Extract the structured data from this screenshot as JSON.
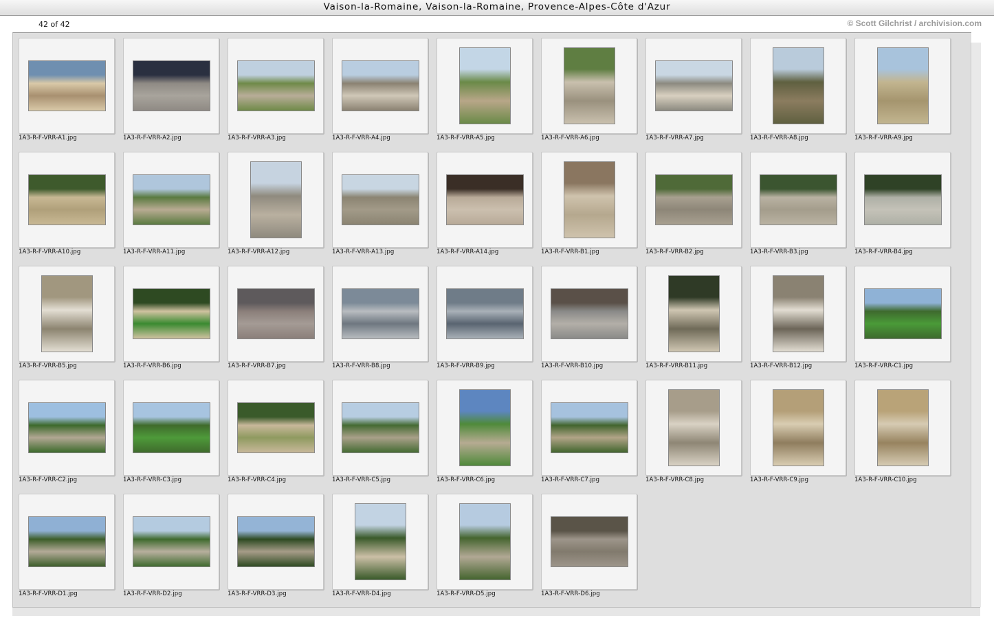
{
  "window": {
    "title": "Vaison-la-Romaine, Vaison-la-Romaine, Provence-Alpes-Côte d'Azur"
  },
  "status": {
    "count": "42 of 42",
    "credit": "© Scott Gilchrist / archivision.com"
  },
  "thumbnails": [
    {
      "file": "1A3-R-F-VRR-A1.jpg",
      "orientation": "landscape",
      "colors": [
        "#6f8fb0",
        "#d9c9a8",
        "#a89070"
      ]
    },
    {
      "file": "1A3-R-F-VRR-A2.jpg",
      "orientation": "landscape",
      "colors": [
        "#2a3040",
        "#8f8a84",
        "#a8a49c"
      ]
    },
    {
      "file": "1A3-R-F-VRR-A3.jpg",
      "orientation": "landscape",
      "colors": [
        "#bfd0df",
        "#6f8a48",
        "#b8ad98"
      ]
    },
    {
      "file": "1A3-R-F-VRR-A4.jpg",
      "orientation": "landscape",
      "colors": [
        "#b9cde0",
        "#8b8272",
        "#cfc7b7"
      ]
    },
    {
      "file": "1A3-R-F-VRR-A5.jpg",
      "orientation": "portrait",
      "colors": [
        "#c3d6e6",
        "#6a8a48",
        "#b8a688"
      ]
    },
    {
      "file": "1A3-R-F-VRR-A6.jpg",
      "orientation": "portrait",
      "colors": [
        "#5f7e42",
        "#c9c0ae",
        "#9a917e"
      ]
    },
    {
      "file": "1A3-R-F-VRR-A7.jpg",
      "orientation": "landscape",
      "colors": [
        "#c9d7e3",
        "#8c8a80",
        "#d8d0c0"
      ]
    },
    {
      "file": "1A3-R-F-VRR-A8.jpg",
      "orientation": "portrait",
      "colors": [
        "#b9cbdb",
        "#5f6040",
        "#8b7c5f"
      ]
    },
    {
      "file": "1A3-R-F-VRR-A9.jpg",
      "orientation": "portrait",
      "colors": [
        "#a8c3dc",
        "#c2b590",
        "#a5956e"
      ]
    },
    {
      "file": "1A3-R-F-VRR-A10.jpg",
      "orientation": "landscape",
      "colors": [
        "#3e5a2c",
        "#c8b894",
        "#b0a07a"
      ]
    },
    {
      "file": "1A3-R-F-VRR-A11.jpg",
      "orientation": "landscape",
      "colors": [
        "#afc6dc",
        "#5a7a40",
        "#b8ab92"
      ]
    },
    {
      "file": "1A3-R-F-VRR-A12.jpg",
      "orientation": "portrait",
      "colors": [
        "#c6d3e0",
        "#8f8a7e",
        "#b9b0a0"
      ]
    },
    {
      "file": "1A3-R-F-VRR-A13.jpg",
      "orientation": "landscape",
      "colors": [
        "#c8d6e2",
        "#8b8472",
        "#a29a88"
      ]
    },
    {
      "file": "1A3-R-F-VRR-A14.jpg",
      "orientation": "landscape",
      "colors": [
        "#3a2e26",
        "#b8aa98",
        "#cbbfae"
      ]
    },
    {
      "file": "1A3-R-F-VRR-B1.jpg",
      "orientation": "portrait",
      "colors": [
        "#8a7660",
        "#cfc3ad",
        "#b5a88e"
      ]
    },
    {
      "file": "1A3-R-F-VRR-B2.jpg",
      "orientation": "landscape",
      "colors": [
        "#4f6a38",
        "#a8a090",
        "#8d8678"
      ]
    },
    {
      "file": "1A3-R-F-VRR-B3.jpg",
      "orientation": "landscape",
      "colors": [
        "#3b5530",
        "#b9b2a2",
        "#a49d8c"
      ]
    },
    {
      "file": "1A3-R-F-VRR-B4.jpg",
      "orientation": "landscape",
      "colors": [
        "#2f4226",
        "#aeb0a6",
        "#c4c2b8"
      ]
    },
    {
      "file": "1A3-R-F-VRR-B5.jpg",
      "orientation": "portrait",
      "colors": [
        "#a1977f",
        "#e3ded3",
        "#8c8470"
      ]
    },
    {
      "file": "1A3-R-F-VRR-B6.jpg",
      "orientation": "landscape",
      "colors": [
        "#2e4a22",
        "#cfc2a0",
        "#3a8a30"
      ]
    },
    {
      "file": "1A3-R-F-VRR-B7.jpg",
      "orientation": "landscape",
      "colors": [
        "#5e5a5c",
        "#8b7f7a",
        "#a49b95"
      ]
    },
    {
      "file": "1A3-R-F-VRR-B8.jpg",
      "orientation": "landscape",
      "colors": [
        "#7c8a98",
        "#b8bcc0",
        "#6e7780"
      ]
    },
    {
      "file": "1A3-R-F-VRR-B9.jpg",
      "orientation": "landscape",
      "colors": [
        "#6f7c88",
        "#a9b1b8",
        "#596470"
      ]
    },
    {
      "file": "1A3-R-F-VRR-B10.jpg",
      "orientation": "landscape",
      "colors": [
        "#5a5048",
        "#8a8a88",
        "#b3afa8"
      ]
    },
    {
      "file": "1A3-R-F-VRR-B11.jpg",
      "orientation": "portrait",
      "colors": [
        "#2f3a26",
        "#cfc6b2",
        "#6f6a58"
      ]
    },
    {
      "file": "1A3-R-F-VRR-B12.jpg",
      "orientation": "portrait",
      "colors": [
        "#8a8272",
        "#e2ddd2",
        "#6c6558"
      ]
    },
    {
      "file": "1A3-R-F-VRR-C1.jpg",
      "orientation": "landscape",
      "colors": [
        "#8fb2d6",
        "#3e6a2e",
        "#4a9a38"
      ]
    },
    {
      "file": "1A3-R-F-VRR-C2.jpg",
      "orientation": "landscape",
      "colors": [
        "#9dbfe0",
        "#3d6a2c",
        "#b1a793"
      ]
    },
    {
      "file": "1A3-R-F-VRR-C3.jpg",
      "orientation": "landscape",
      "colors": [
        "#a7c4e0",
        "#3f6b2c",
        "#4e9a3a"
      ]
    },
    {
      "file": "1A3-R-F-VRR-C4.jpg",
      "orientation": "landscape",
      "colors": [
        "#3a5a2a",
        "#c8b89a",
        "#8f9a60"
      ]
    },
    {
      "file": "1A3-R-F-VRR-C5.jpg",
      "orientation": "landscape",
      "colors": [
        "#b7cde2",
        "#456b33",
        "#a9a089"
      ]
    },
    {
      "file": "1A3-R-F-VRR-C6.jpg",
      "orientation": "portrait",
      "colors": [
        "#5d86c0",
        "#4f8a3a",
        "#b6ab92"
      ]
    },
    {
      "file": "1A3-R-F-VRR-C7.jpg",
      "orientation": "landscape",
      "colors": [
        "#a6c2de",
        "#42652e",
        "#b1a487"
      ]
    },
    {
      "file": "1A3-R-F-VRR-C8.jpg",
      "orientation": "portrait",
      "colors": [
        "#a79d8a",
        "#d9d2c4",
        "#8e8675"
      ]
    },
    {
      "file": "1A3-R-F-VRR-C9.jpg",
      "orientation": "portrait",
      "colors": [
        "#b49f78",
        "#d9cdb2",
        "#8f7d5e"
      ]
    },
    {
      "file": "1A3-R-F-VRR-C10.jpg",
      "orientation": "portrait",
      "colors": [
        "#b9a378",
        "#d6cbb3",
        "#97835f"
      ]
    },
    {
      "file": "1A3-R-F-VRR-D1.jpg",
      "orientation": "landscape",
      "colors": [
        "#8fb0d4",
        "#3d5e2a",
        "#b3aa98"
      ]
    },
    {
      "file": "1A3-R-F-VRR-D2.jpg",
      "orientation": "landscape",
      "colors": [
        "#b4cbe0",
        "#3f6a2e",
        "#b7af9e"
      ]
    },
    {
      "file": "1A3-R-F-VRR-D3.jpg",
      "orientation": "landscape",
      "colors": [
        "#94b4d6",
        "#2e4a22",
        "#a69c88"
      ]
    },
    {
      "file": "1A3-R-F-VRR-D4.jpg",
      "orientation": "portrait",
      "colors": [
        "#c2d3e3",
        "#3a5a2a",
        "#cbbfa6"
      ]
    },
    {
      "file": "1A3-R-F-VRR-D5.jpg",
      "orientation": "portrait",
      "colors": [
        "#b6cbe0",
        "#45652f",
        "#b1a894"
      ]
    },
    {
      "file": "1A3-R-F-VRR-D6.jpg",
      "orientation": "landscape",
      "colors": [
        "#5a5448",
        "#9d958a",
        "#817a6d"
      ]
    }
  ]
}
